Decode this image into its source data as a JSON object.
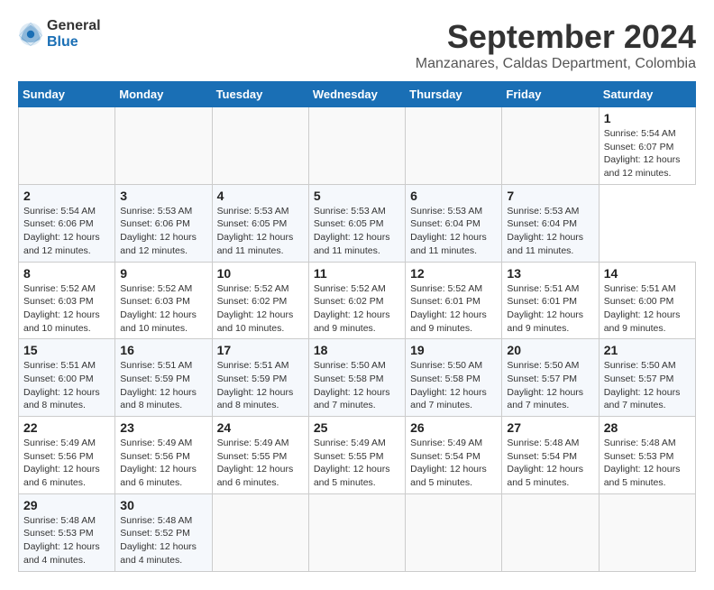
{
  "header": {
    "logo_general": "General",
    "logo_blue": "Blue",
    "title": "September 2024",
    "subtitle": "Manzanares, Caldas Department, Colombia"
  },
  "calendar": {
    "days_of_week": [
      "Sunday",
      "Monday",
      "Tuesday",
      "Wednesday",
      "Thursday",
      "Friday",
      "Saturday"
    ],
    "weeks": [
      [
        null,
        null,
        null,
        null,
        null,
        null,
        {
          "day": "1",
          "sunrise": "Sunrise: 5:54 AM",
          "sunset": "Sunset: 6:07 PM",
          "daylight": "Daylight: 12 hours and 12 minutes."
        }
      ],
      [
        {
          "day": "2",
          "sunrise": "Sunrise: 5:54 AM",
          "sunset": "Sunset: 6:06 PM",
          "daylight": "Daylight: 12 hours and 12 minutes."
        },
        {
          "day": "3",
          "sunrise": "Sunrise: 5:53 AM",
          "sunset": "Sunset: 6:06 PM",
          "daylight": "Daylight: 12 hours and 12 minutes."
        },
        {
          "day": "4",
          "sunrise": "Sunrise: 5:53 AM",
          "sunset": "Sunset: 6:05 PM",
          "daylight": "Daylight: 12 hours and 11 minutes."
        },
        {
          "day": "5",
          "sunrise": "Sunrise: 5:53 AM",
          "sunset": "Sunset: 6:05 PM",
          "daylight": "Daylight: 12 hours and 11 minutes."
        },
        {
          "day": "6",
          "sunrise": "Sunrise: 5:53 AM",
          "sunset": "Sunset: 6:04 PM",
          "daylight": "Daylight: 12 hours and 11 minutes."
        },
        {
          "day": "7",
          "sunrise": "Sunrise: 5:53 AM",
          "sunset": "Sunset: 6:04 PM",
          "daylight": "Daylight: 12 hours and 11 minutes."
        }
      ],
      [
        {
          "day": "8",
          "sunrise": "Sunrise: 5:52 AM",
          "sunset": "Sunset: 6:03 PM",
          "daylight": "Daylight: 12 hours and 10 minutes."
        },
        {
          "day": "9",
          "sunrise": "Sunrise: 5:52 AM",
          "sunset": "Sunset: 6:03 PM",
          "daylight": "Daylight: 12 hours and 10 minutes."
        },
        {
          "day": "10",
          "sunrise": "Sunrise: 5:52 AM",
          "sunset": "Sunset: 6:02 PM",
          "daylight": "Daylight: 12 hours and 10 minutes."
        },
        {
          "day": "11",
          "sunrise": "Sunrise: 5:52 AM",
          "sunset": "Sunset: 6:02 PM",
          "daylight": "Daylight: 12 hours and 9 minutes."
        },
        {
          "day": "12",
          "sunrise": "Sunrise: 5:52 AM",
          "sunset": "Sunset: 6:01 PM",
          "daylight": "Daylight: 12 hours and 9 minutes."
        },
        {
          "day": "13",
          "sunrise": "Sunrise: 5:51 AM",
          "sunset": "Sunset: 6:01 PM",
          "daylight": "Daylight: 12 hours and 9 minutes."
        },
        {
          "day": "14",
          "sunrise": "Sunrise: 5:51 AM",
          "sunset": "Sunset: 6:00 PM",
          "daylight": "Daylight: 12 hours and 9 minutes."
        }
      ],
      [
        {
          "day": "15",
          "sunrise": "Sunrise: 5:51 AM",
          "sunset": "Sunset: 6:00 PM",
          "daylight": "Daylight: 12 hours and 8 minutes."
        },
        {
          "day": "16",
          "sunrise": "Sunrise: 5:51 AM",
          "sunset": "Sunset: 5:59 PM",
          "daylight": "Daylight: 12 hours and 8 minutes."
        },
        {
          "day": "17",
          "sunrise": "Sunrise: 5:51 AM",
          "sunset": "Sunset: 5:59 PM",
          "daylight": "Daylight: 12 hours and 8 minutes."
        },
        {
          "day": "18",
          "sunrise": "Sunrise: 5:50 AM",
          "sunset": "Sunset: 5:58 PM",
          "daylight": "Daylight: 12 hours and 7 minutes."
        },
        {
          "day": "19",
          "sunrise": "Sunrise: 5:50 AM",
          "sunset": "Sunset: 5:58 PM",
          "daylight": "Daylight: 12 hours and 7 minutes."
        },
        {
          "day": "20",
          "sunrise": "Sunrise: 5:50 AM",
          "sunset": "Sunset: 5:57 PM",
          "daylight": "Daylight: 12 hours and 7 minutes."
        },
        {
          "day": "21",
          "sunrise": "Sunrise: 5:50 AM",
          "sunset": "Sunset: 5:57 PM",
          "daylight": "Daylight: 12 hours and 7 minutes."
        }
      ],
      [
        {
          "day": "22",
          "sunrise": "Sunrise: 5:49 AM",
          "sunset": "Sunset: 5:56 PM",
          "daylight": "Daylight: 12 hours and 6 minutes."
        },
        {
          "day": "23",
          "sunrise": "Sunrise: 5:49 AM",
          "sunset": "Sunset: 5:56 PM",
          "daylight": "Daylight: 12 hours and 6 minutes."
        },
        {
          "day": "24",
          "sunrise": "Sunrise: 5:49 AM",
          "sunset": "Sunset: 5:55 PM",
          "daylight": "Daylight: 12 hours and 6 minutes."
        },
        {
          "day": "25",
          "sunrise": "Sunrise: 5:49 AM",
          "sunset": "Sunset: 5:55 PM",
          "daylight": "Daylight: 12 hours and 5 minutes."
        },
        {
          "day": "26",
          "sunrise": "Sunrise: 5:49 AM",
          "sunset": "Sunset: 5:54 PM",
          "daylight": "Daylight: 12 hours and 5 minutes."
        },
        {
          "day": "27",
          "sunrise": "Sunrise: 5:48 AM",
          "sunset": "Sunset: 5:54 PM",
          "daylight": "Daylight: 12 hours and 5 minutes."
        },
        {
          "day": "28",
          "sunrise": "Sunrise: 5:48 AM",
          "sunset": "Sunset: 5:53 PM",
          "daylight": "Daylight: 12 hours and 5 minutes."
        }
      ],
      [
        {
          "day": "29",
          "sunrise": "Sunrise: 5:48 AM",
          "sunset": "Sunset: 5:53 PM",
          "daylight": "Daylight: 12 hours and 4 minutes."
        },
        {
          "day": "30",
          "sunrise": "Sunrise: 5:48 AM",
          "sunset": "Sunset: 5:52 PM",
          "daylight": "Daylight: 12 hours and 4 minutes."
        },
        null,
        null,
        null,
        null,
        null
      ]
    ]
  }
}
